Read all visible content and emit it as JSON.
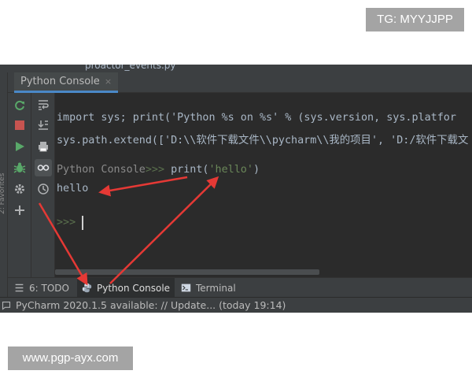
{
  "watermark": {
    "top": "TG: MYYJJPP",
    "bottom": "www.pgp-ayx.com"
  },
  "editor": {
    "file_tab": "proactor_events.py"
  },
  "left_strip": {
    "label": "2: Favorites"
  },
  "tool_window": {
    "tab_label": "Python Console",
    "close_glyph": "×"
  },
  "toolbar_left": [
    {
      "icon": "rerun-icon",
      "color": "#59a869"
    },
    {
      "icon": "stop-icon",
      "color": "#c75450"
    },
    {
      "icon": "run-icon",
      "color": "#59a869"
    },
    {
      "icon": "debug-icon",
      "color": "#59a869"
    },
    {
      "icon": "settings-icon",
      "color": "#afb1b3"
    },
    {
      "icon": "add-icon",
      "color": "#afb1b3"
    }
  ],
  "toolbar_right": [
    {
      "icon": "soft-wrap-icon"
    },
    {
      "icon": "scroll-to-end-icon"
    },
    {
      "icon": "print-icon"
    },
    {
      "icon": "show-variables-icon"
    },
    {
      "icon": "history-icon"
    }
  ],
  "console": {
    "line1": "import sys; print('Python %s on %s' % (sys.version, sys.platfor",
    "line2": "sys.path.extend(['D:\\\\软件下载文件\\\\pycharm\\\\我的项目', 'D:/软件下载文",
    "prompt_name": "Python Console",
    "prompt_marker": ">>> ",
    "command_prefix": "print(",
    "command_string": "'hello'",
    "command_suffix": ")",
    "output": "hello",
    "empty_prompt": ">>>"
  },
  "bottom_tabs": {
    "todo": "6: TODO",
    "python_console": "Python Console",
    "terminal": "Terminal"
  },
  "status": {
    "message": "PyCharm 2020.1.5 available: // Update... (today 19:14)"
  },
  "colors": {
    "background": "#2b2b2b",
    "panel": "#3c3f41",
    "text": "#a9b7c6",
    "string": "#6a8759",
    "annotation_arrow": "#e53935",
    "tab_underline": "#4a88c7"
  }
}
